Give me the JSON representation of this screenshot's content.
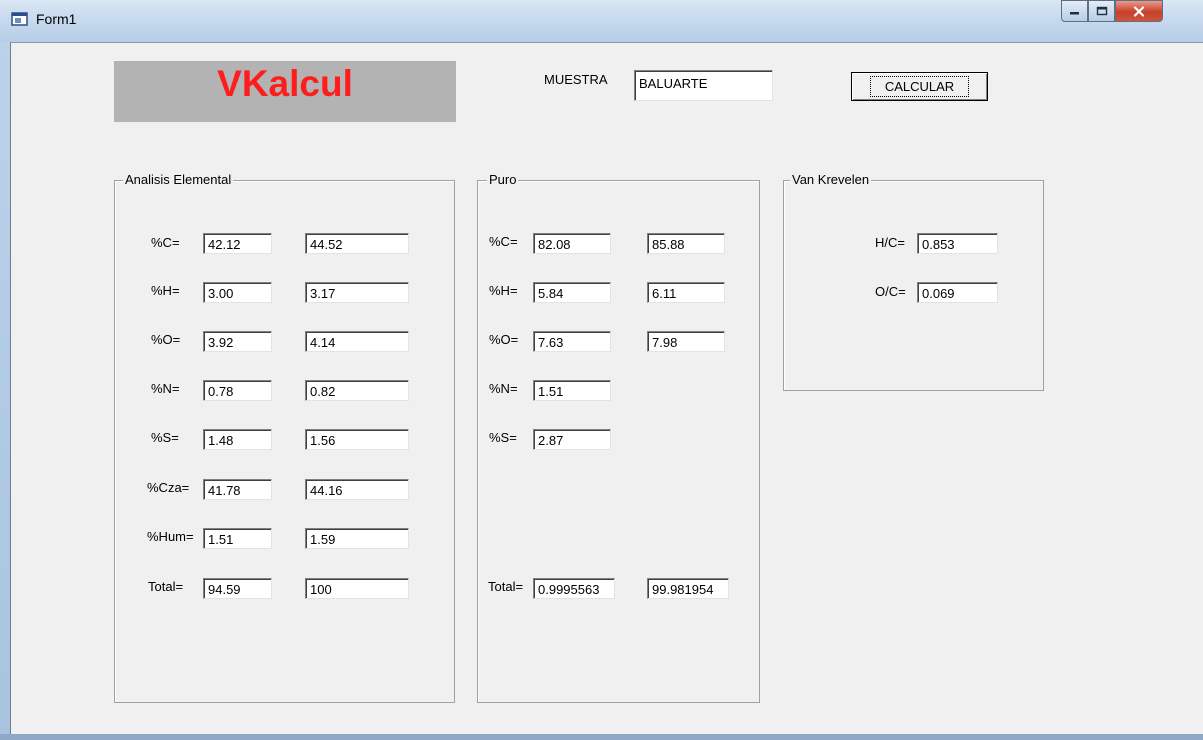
{
  "window": {
    "title": "Form1"
  },
  "app": {
    "logo": "VKalcul"
  },
  "muestra": {
    "label": "MUESTRA",
    "value": "BALUARTE"
  },
  "calcular_label": "CALCULAR",
  "analisis": {
    "title": "Analisis Elemental",
    "rows": [
      {
        "label": "%C=",
        "v1": "42.12",
        "v2": "44.52"
      },
      {
        "label": "%H=",
        "v1": "3.00",
        "v2": "3.17"
      },
      {
        "label": "%O=",
        "v1": "3.92",
        "v2": "4.14"
      },
      {
        "label": "%N=",
        "v1": "0.78",
        "v2": "0.82"
      },
      {
        "label": "%S=",
        "v1": "1.48",
        "v2": "1.56"
      },
      {
        "label": "%Cza=",
        "v1": "41.78",
        "v2": "44.16"
      },
      {
        "label": "%Hum=",
        "v1": "1.51",
        "v2": "1.59"
      },
      {
        "label": "Total=",
        "v1": "94.59",
        "v2": "100"
      }
    ]
  },
  "puro": {
    "title": "Puro",
    "rows": [
      {
        "label": "%C=",
        "v1": "82.08",
        "v2": "85.88"
      },
      {
        "label": "%H=",
        "v1": "5.84",
        "v2": "6.11"
      },
      {
        "label": "%O=",
        "v1": "7.63",
        "v2": "7.98"
      },
      {
        "label": "%N=",
        "v1": "1.51"
      },
      {
        "label": "%S=",
        "v1": "2.87"
      }
    ],
    "total": {
      "label": "Total=",
      "v1": "0.9995563",
      "v2": "99.981954"
    }
  },
  "vank": {
    "title": "Van Krevelen",
    "rows": [
      {
        "label": "H/C=",
        "v1": "0.853"
      },
      {
        "label": "O/C=",
        "v1": "0.069"
      }
    ]
  }
}
